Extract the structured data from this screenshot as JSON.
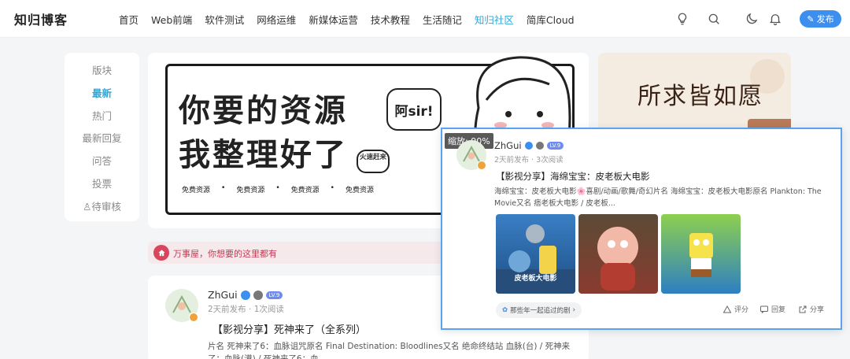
{
  "header": {
    "logo": "知归博客",
    "nav": [
      "首页",
      "Web前端",
      "软件测试",
      "网络运维",
      "新媒体运营",
      "技术教程",
      "生活随记",
      "知归社区",
      "简库Cloud"
    ],
    "nav_active_index": 7,
    "icons": [
      "lightbulb-icon",
      "search-icon",
      "moon-icon",
      "bell-icon"
    ],
    "publish_label": "发布"
  },
  "filters": {
    "items": [
      "版块",
      "最新",
      "热门",
      "最新回复",
      "问答",
      "投票",
      "待审核"
    ],
    "active_index": 1
  },
  "banner": {
    "line1": "你要的资源",
    "line2": "我整理好了",
    "bubble": "阿sir!",
    "small_bubble": "火速赶来",
    "tags": [
      "免费资源",
      "免费资源",
      "免费资源",
      "免费资源"
    ]
  },
  "promo": {
    "title": "所求皆如愿"
  },
  "notice": {
    "text": "万事屋，你想要的这里都有"
  },
  "post": {
    "author": "ZhGui",
    "level": "LV.9",
    "meta": "2天前发布 · 1次阅读",
    "title": "【影视分享】死神来了（全系列）",
    "excerpt": "片名 死神来了6：血脉诅咒原名 Final Destination: Bloodlines又名 绝命终结站 血脉(台) / 死神来了：血脉(港) / 死神来了6：血..."
  },
  "popup": {
    "zoom": "缩放: 90%",
    "author": "ZhGui",
    "level": "LV.9",
    "meta": "2天前发布 · 3次阅读",
    "title": "【影视分享】海绵宝宝：皮老板大电影",
    "excerpt": "海绵宝宝：皮老板大电影🌸喜剧/动画/歌舞/奇幻片名 海绵宝宝：皮老板大电影原名 Plankton: The Movie又名 痞老板大电影 / 皮老板...",
    "thumb_captions": [
      "皮老板大电影",
      "",
      ""
    ],
    "chip": "那些年一起追过的剧",
    "actions": [
      "评分",
      "回复",
      "分享"
    ]
  },
  "colors": {
    "accent": "#2fa8d8",
    "primary": "#3d8fef",
    "notice": "#c23a52"
  }
}
